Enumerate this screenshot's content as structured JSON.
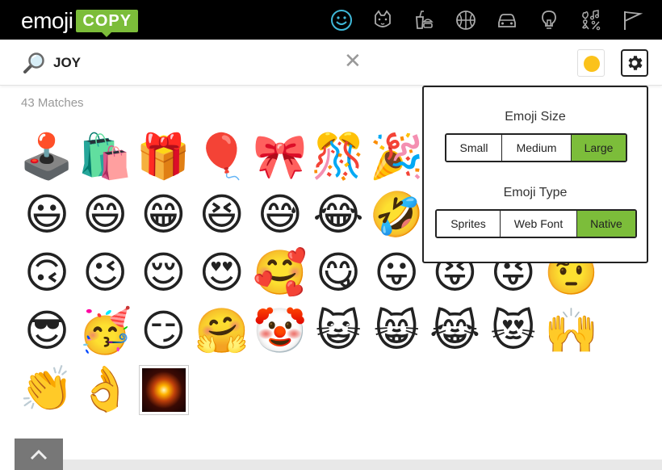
{
  "header": {
    "logo_word": "emoji",
    "logo_badge": "COPY",
    "categories": [
      {
        "name": "smileys-icon",
        "active": true
      },
      {
        "name": "animals-icon",
        "active": false
      },
      {
        "name": "food-icon",
        "active": false
      },
      {
        "name": "activities-icon",
        "active": false
      },
      {
        "name": "travel-icon",
        "active": false
      },
      {
        "name": "objects-icon",
        "active": false
      },
      {
        "name": "symbols-icon",
        "active": false
      },
      {
        "name": "flags-icon",
        "active": false
      }
    ],
    "accent_color": "#7cbd3a",
    "active_icon_color": "#3fb8d8"
  },
  "search": {
    "value": "JOY",
    "clear_glyph": "✕",
    "skin_tone_color": "#fbc21b"
  },
  "results": {
    "matches_label": "43 Matches",
    "rows": [
      [
        "🕹️",
        "🛍️",
        "🎁",
        "🎈",
        "🎀",
        "🎊",
        "🎉"
      ],
      [
        "😃",
        "😄",
        "😁",
        "😆",
        "😅",
        "😂",
        "🤣"
      ],
      [
        "🙃",
        "😉",
        "😌",
        "😍",
        "🥰",
        "😋",
        "😛",
        "😝",
        "😜",
        "🤨"
      ],
      [
        "😎",
        "🥳",
        "😏",
        "🤗",
        "🤡",
        "😺",
        "😸",
        "😹",
        "😻",
        "🙌"
      ],
      [
        "👏",
        "👌"
      ]
    ],
    "last_item_name": "sparkler"
  },
  "settings_panel": {
    "size_label": "Emoji Size",
    "size_options": [
      "Small",
      "Medium",
      "Large"
    ],
    "size_selected": "Large",
    "type_label": "Emoji Type",
    "type_options": [
      "Sprites",
      "Web Font",
      "Native"
    ],
    "type_selected": "Native"
  }
}
